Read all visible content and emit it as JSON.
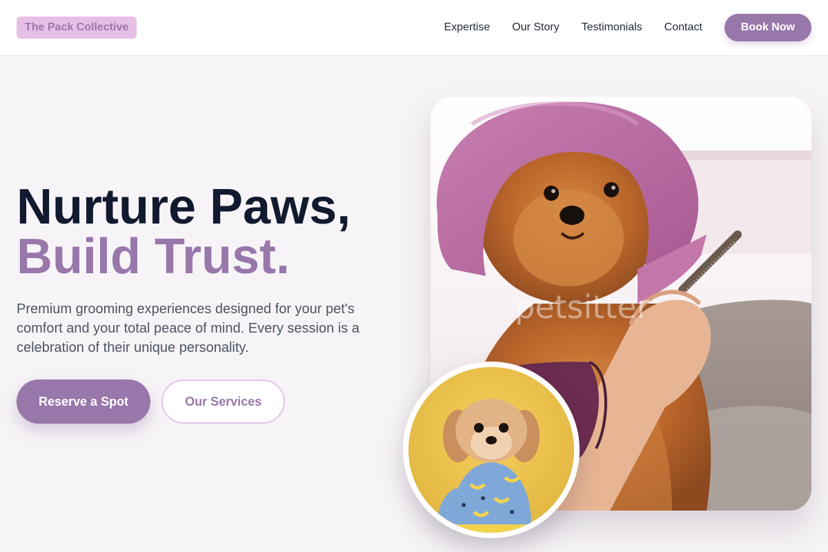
{
  "brand": {
    "name": "The Pack Collective"
  },
  "nav": {
    "links": [
      "Expertise",
      "Our Story",
      "Testimonials",
      "Contact"
    ],
    "cta": "Book Now"
  },
  "hero": {
    "title_line_1": "Nurture Paws,",
    "title_line_2": "Build Trust.",
    "description": "Premium grooming experiences designed for your pet's comfort and your total peace of mind. Every session is a celebration of their unique personality.",
    "primary_cta": "Reserve a Spot",
    "secondary_cta": "Our Services"
  },
  "images": {
    "main_photo": {
      "subject": "pomeranian-in-pink-towel-being-combed",
      "watermark": "petsitter"
    },
    "round_photo": {
      "subject": "small-dog-in-blue-banana-shirt-on-yellow"
    }
  },
  "colors": {
    "accent": "#9877aa",
    "logo_bg": "#e5bfe6",
    "heading": "#111a2e",
    "body_text": "#4b5563",
    "page_bg": "#f7f4f7"
  }
}
